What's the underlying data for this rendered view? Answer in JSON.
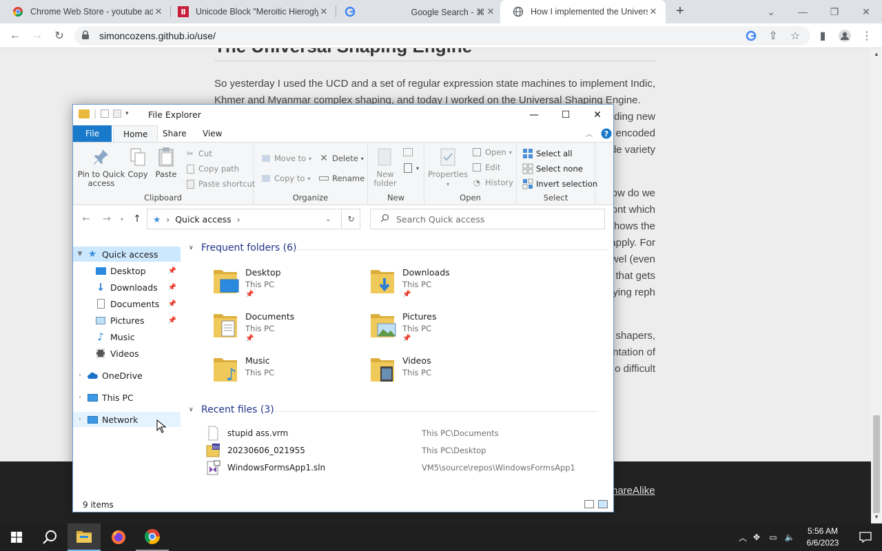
{
  "browser": {
    "tabs": [
      {
        "title": "Chrome Web Store - youtube ad",
        "close": "✕"
      },
      {
        "title": "Unicode Block \"Meroitic Hierogly",
        "close": "✕"
      },
      {
        "title": "Google Search - ⌘",
        "close": "✕"
      },
      {
        "title": "How I implemented the Universa",
        "close": "✕"
      }
    ],
    "url": "simoncozens.github.io/use/",
    "new_tab": "+"
  },
  "article": {
    "title": "The Universal Shaping Engine",
    "paragraphs": [
      "So yesterday I used the UCD and a set of regular expression state machines to implement Indic, Khmer and Myanmar complex shaping, and today I worked on the Universal Shaping Engine.",
      "ding new",
      "encoded",
      "de variety",
      "ow do we",
      "ont which",
      "hows the",
      "apply. For",
      "wel (even",
      "that gets",
      "ying reph",
      "t shapers,",
      "ntation of",
      "o difficult"
    ],
    "footer_link": "hareAlike"
  },
  "explorer": {
    "title": "File Explorer",
    "tabs": {
      "file": "File",
      "home": "Home",
      "share": "Share",
      "view": "View"
    },
    "ribbon": {
      "clipboard": {
        "label": "Clipboard",
        "pin": "Pin to Quick access",
        "copy": "Copy",
        "paste": "Paste",
        "cut": "Cut",
        "copy_path": "Copy path",
        "paste_shortcut": "Paste shortcut"
      },
      "organize": {
        "label": "Organize",
        "move_to": "Move to",
        "copy_to": "Copy to",
        "delete": "Delete",
        "rename": "Rename"
      },
      "new": {
        "label": "New",
        "new_folder": "New folder"
      },
      "open": {
        "label": "Open",
        "properties": "Properties",
        "open": "Open",
        "edit": "Edit",
        "history": "History"
      },
      "select": {
        "label": "Select",
        "select_all": "Select all",
        "select_none": "Select none",
        "invert": "Invert selection"
      }
    },
    "address": {
      "path": "Quick access",
      "search_placeholder": "Search Quick access"
    },
    "nav": {
      "quick_access": "Quick access",
      "pinned": [
        {
          "label": "Desktop",
          "pinned": true
        },
        {
          "label": "Downloads",
          "pinned": true
        },
        {
          "label": "Documents",
          "pinned": true
        },
        {
          "label": "Pictures",
          "pinned": true
        },
        {
          "label": "Music",
          "pinned": false
        },
        {
          "label": "Videos",
          "pinned": false
        }
      ],
      "onedrive": "OneDrive",
      "this_pc": "This PC",
      "network": "Network"
    },
    "frequent": {
      "heading": "Frequent folders (6)",
      "items": [
        {
          "name": "Desktop",
          "location": "This PC"
        },
        {
          "name": "Downloads",
          "location": "This PC"
        },
        {
          "name": "Documents",
          "location": "This PC"
        },
        {
          "name": "Pictures",
          "location": "This PC"
        },
        {
          "name": "Music",
          "location": "This PC"
        },
        {
          "name": "Videos",
          "location": "This PC"
        }
      ]
    },
    "recent": {
      "heading": "Recent files (3)",
      "items": [
        {
          "name": "stupid ass.vrm",
          "path": "This PC\\Documents"
        },
        {
          "name": "20230606_021955",
          "path": "This PC\\Desktop"
        },
        {
          "name": "WindowsFormsApp1.sln",
          "path": "VM5\\source\\repos\\WindowsFormsApp1"
        }
      ]
    },
    "status": "9 items"
  },
  "taskbar": {
    "time": "5:56 AM",
    "date": "6/6/2023"
  },
  "colors": {
    "file_tab": "#1979ca",
    "selection": "#cce8ff",
    "folder": "#e8b93a",
    "accent_blue": "#1e3287"
  }
}
